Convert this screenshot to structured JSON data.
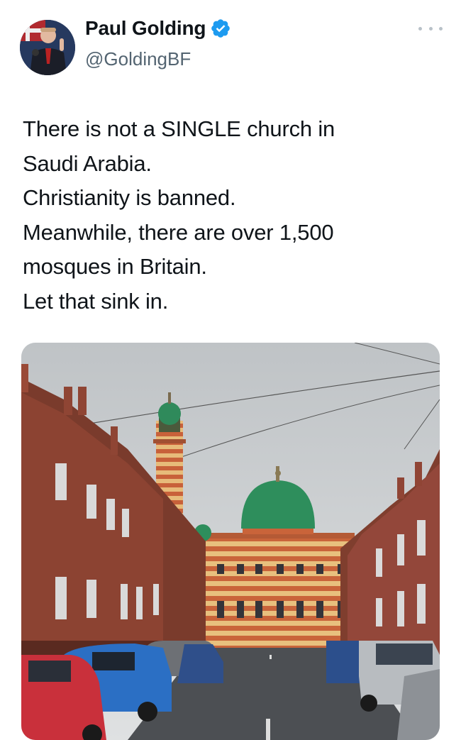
{
  "author": {
    "display_name": "Paul Golding",
    "handle": "@GoldingBF",
    "verified": true,
    "verified_icon": "verified-badge-icon",
    "badge_color": "#1d9bf0"
  },
  "more_icon": "more-options-icon",
  "tweet": {
    "lines": [
      "There is not a SINGLE church in",
      "Saudi Arabia.",
      "Christianity is banned.",
      "Meanwhile, there are over 1,500",
      "mosques in Britain.",
      "Let that sink in."
    ]
  },
  "media": {
    "type": "photo"
  }
}
